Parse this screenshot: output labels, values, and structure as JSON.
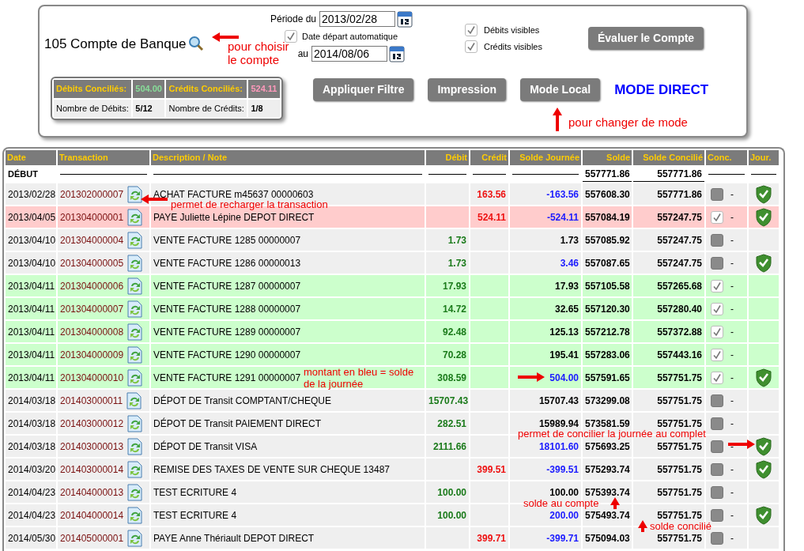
{
  "filter_panel": {
    "account": "105 Compte de Banque",
    "period_from_label": "Période du",
    "period_from": "2013/02/28",
    "auto_start": {
      "label": "Date départ automatique",
      "checked": true
    },
    "period_to_label": "au",
    "period_to": "2014/08/06",
    "visibility": [
      {
        "label": "Débits visibles",
        "checked": true
      },
      {
        "label": "Crédits visibles",
        "checked": true
      }
    ],
    "evaluate_button": "Évaluer le Compte",
    "summary": {
      "debits_label": "Débits Conciliés:",
      "debits_value": "504.00",
      "credits_label": "Crédits Conciliés:",
      "credits_value": "524.11",
      "debit_count_label": "Nombre de Débits:",
      "debit_count": "5/12",
      "credit_count_label": "Nombre de Crédits:",
      "credit_count": "1/8"
    },
    "buttons": [
      "Appliquer Filtre",
      "Impression",
      "Mode Local"
    ],
    "mode": "MODE DIRECT"
  },
  "table": {
    "columns": [
      "Date",
      "Transaction",
      "Description / Note",
      "Débit",
      "Crédit",
      "Solde Journée",
      "Solde",
      "Solde Concilié",
      "Conc.",
      "Jour."
    ],
    "start_row": {
      "label": "DÉBUT",
      "balance": "557771.86",
      "reconciled_balance": "557771.86"
    },
    "rows": [
      {
        "date": "2013/02/28",
        "transaction": "201302000007",
        "description": "ACHAT FACTURE m45637 00000603",
        "debit": "",
        "credit": "163.56",
        "day_balance": "-163.56",
        "day_total": true,
        "balance": "557608.30",
        "reconciled_balance": "557771.86",
        "checked": false,
        "note": "-",
        "day_reconcile": true
      },
      {
        "date": "2013/04/05",
        "transaction": "201304000001",
        "description": "PAYE Juliette Lépine DEPOT DIRECT",
        "debit": "",
        "credit": "524.11",
        "day_balance": "-524.11",
        "day_total": true,
        "balance": "557084.19",
        "reconciled_balance": "557247.75",
        "checked": true,
        "note": "-",
        "day_reconcile": true
      },
      {
        "date": "2013/04/10",
        "transaction": "201304000004",
        "description": "VENTE FACTURE 1285 00000007",
        "debit": "1.73",
        "credit": "",
        "day_balance": "1.73",
        "day_total": false,
        "balance": "557085.92",
        "reconciled_balance": "557247.75",
        "checked": false,
        "note": "-",
        "day_reconcile": false
      },
      {
        "date": "2013/04/10",
        "transaction": "201304000005",
        "description": "VENTE FACTURE 1286 00000013",
        "debit": "1.73",
        "credit": "",
        "day_balance": "3.46",
        "day_total": true,
        "balance": "557087.65",
        "reconciled_balance": "557247.75",
        "checked": false,
        "note": "-",
        "day_reconcile": true
      },
      {
        "date": "2013/04/11",
        "transaction": "201304000006",
        "description": "VENTE FACTURE 1287 00000007",
        "debit": "17.93",
        "credit": "",
        "day_balance": "17.93",
        "day_total": false,
        "balance": "557105.58",
        "reconciled_balance": "557265.68",
        "checked": true,
        "note": "-",
        "day_reconcile": false
      },
      {
        "date": "2013/04/11",
        "transaction": "201304000007",
        "description": "VENTE FACTURE 1288 00000007",
        "debit": "14.72",
        "credit": "",
        "day_balance": "32.65",
        "day_total": false,
        "balance": "557120.30",
        "reconciled_balance": "557280.40",
        "checked": true,
        "note": "-",
        "day_reconcile": false
      },
      {
        "date": "2013/04/11",
        "transaction": "201304000008",
        "description": "VENTE FACTURE 1289 00000007",
        "debit": "92.48",
        "credit": "",
        "day_balance": "125.13",
        "day_total": false,
        "balance": "557212.78",
        "reconciled_balance": "557372.88",
        "checked": true,
        "note": "-",
        "day_reconcile": false
      },
      {
        "date": "2013/04/11",
        "transaction": "201304000009",
        "description": "VENTE FACTURE 1290 00000007",
        "debit": "70.28",
        "credit": "",
        "day_balance": "195.41",
        "day_total": false,
        "balance": "557283.06",
        "reconciled_balance": "557443.16",
        "checked": true,
        "note": "-",
        "day_reconcile": false
      },
      {
        "date": "2013/04/11",
        "transaction": "201304000010",
        "description": "VENTE FACTURE 1291 00000007",
        "debit": "308.59",
        "credit": "",
        "day_balance": "504.00",
        "day_total": true,
        "balance": "557591.65",
        "reconciled_balance": "557751.75",
        "checked": true,
        "note": "-",
        "day_reconcile": true
      },
      {
        "date": "2014/03/18",
        "transaction": "201403000011",
        "description": "DÉPOT DE Transit COMPTANT/CHEQUE",
        "debit": "15707.43",
        "credit": "",
        "day_balance": "15707.43",
        "day_total": false,
        "balance": "573299.08",
        "reconciled_balance": "557751.75",
        "checked": false,
        "note": "-",
        "day_reconcile": false
      },
      {
        "date": "2014/03/18",
        "transaction": "201403000012",
        "description": "DÉPOT DE Transit PAIEMENT DIRECT",
        "debit": "282.51",
        "credit": "",
        "day_balance": "15989.94",
        "day_total": false,
        "balance": "573581.59",
        "reconciled_balance": "557751.75",
        "checked": false,
        "note": "-",
        "day_reconcile": false
      },
      {
        "date": "2014/03/18",
        "transaction": "201403000013",
        "description": "DÉPOT DE Transit VISA",
        "debit": "2111.66",
        "credit": "",
        "day_balance": "18101.60",
        "day_total": true,
        "balance": "575693.25",
        "reconciled_balance": "557751.75",
        "checked": false,
        "note": "-",
        "day_reconcile": true
      },
      {
        "date": "2014/03/20",
        "transaction": "201403000014",
        "description": "REMISE DES TAXES DE VENTE SUR CHEQUE 13487",
        "debit": "",
        "credit": "399.51",
        "day_balance": "-399.51",
        "day_total": true,
        "balance": "575293.74",
        "reconciled_balance": "557751.75",
        "checked": false,
        "note": "-",
        "day_reconcile": true
      },
      {
        "date": "2014/04/23",
        "transaction": "201404000013",
        "description": "TEST ECRITURE 4",
        "debit": "100.00",
        "credit": "",
        "day_balance": "100.00",
        "day_total": false,
        "balance": "575393.74",
        "reconciled_balance": "557751.75",
        "checked": false,
        "note": "-",
        "day_reconcile": false
      },
      {
        "date": "2014/04/23",
        "transaction": "201404000014",
        "description": "TEST ECRITURE 4",
        "debit": "100.00",
        "credit": "",
        "day_balance": "200.00",
        "day_total": true,
        "balance": "575493.74",
        "reconciled_balance": "557751.75",
        "checked": false,
        "note": "-",
        "day_reconcile": true
      },
      {
        "date": "2014/05/30",
        "transaction": "201405000001",
        "description": "PAYE Anne Thériault DEPOT DIRECT",
        "debit": "",
        "credit": "399.71",
        "day_balance": "-399.71",
        "day_total": true,
        "balance": "575094.03",
        "reconciled_balance": "557751.75",
        "checked": false,
        "note": "-",
        "day_reconcile": false
      }
    ]
  },
  "annotations": [
    {
      "kind": "account",
      "text": "pour choisir le compte"
    },
    {
      "kind": "mode",
      "text": "pour changer de mode"
    },
    {
      "kind": "reload",
      "text": "permet de recharger la transaction"
    },
    {
      "kind": "day_balance",
      "text": "montant en bleu = solde de la journée"
    },
    {
      "kind": "reconcile_day",
      "text": "permet de concilier la journée au complet"
    },
    {
      "kind": "balance",
      "text": "solde au compte"
    },
    {
      "kind": "reconciled",
      "text": "solde concilié"
    }
  ]
}
